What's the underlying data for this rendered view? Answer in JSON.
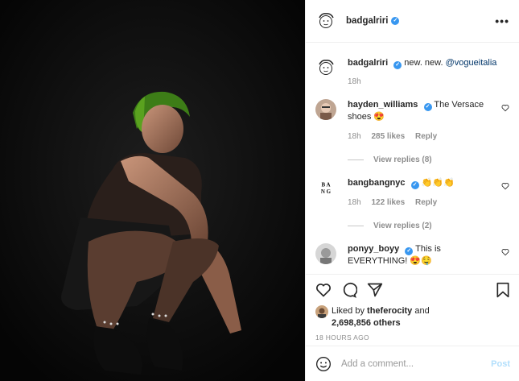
{
  "post": {
    "author": "badgalriri",
    "caption_text": "new. new.",
    "caption_mention": "@vogueitalia",
    "caption_time": "18h"
  },
  "comments": [
    {
      "user": "hayden_williams",
      "text": "The Versace shoes 😍",
      "time": "18h",
      "likes": "285 likes",
      "reply": "Reply",
      "view_replies": "View replies (8)"
    },
    {
      "user": "bangbangnyc",
      "text": "👏👏👏",
      "time": "18h",
      "likes": "122 likes",
      "reply": "Reply",
      "view_replies": "View replies (2)"
    },
    {
      "user": "ponyy_boyy",
      "text": "This is EVERYTHING! 😍🤤"
    }
  ],
  "likes": {
    "prefix": "Liked by",
    "user": "theferocity",
    "joiner": "and",
    "others": "2,698,856 others"
  },
  "timestamp": "18 HOURS AGO",
  "add_comment": {
    "placeholder": "Add a comment...",
    "post_label": "Post"
  },
  "avatar_logo_text": "BANG BANG",
  "colors": {
    "verified": "#3897f0",
    "link": "#003569",
    "muted": "#8e8e8e",
    "post_disabled": "#b2dffc"
  },
  "icons": [
    "more-options-icon",
    "heart-icon",
    "comment-icon",
    "share-icon",
    "bookmark-icon",
    "emoji-icon",
    "verified-badge-icon"
  ]
}
